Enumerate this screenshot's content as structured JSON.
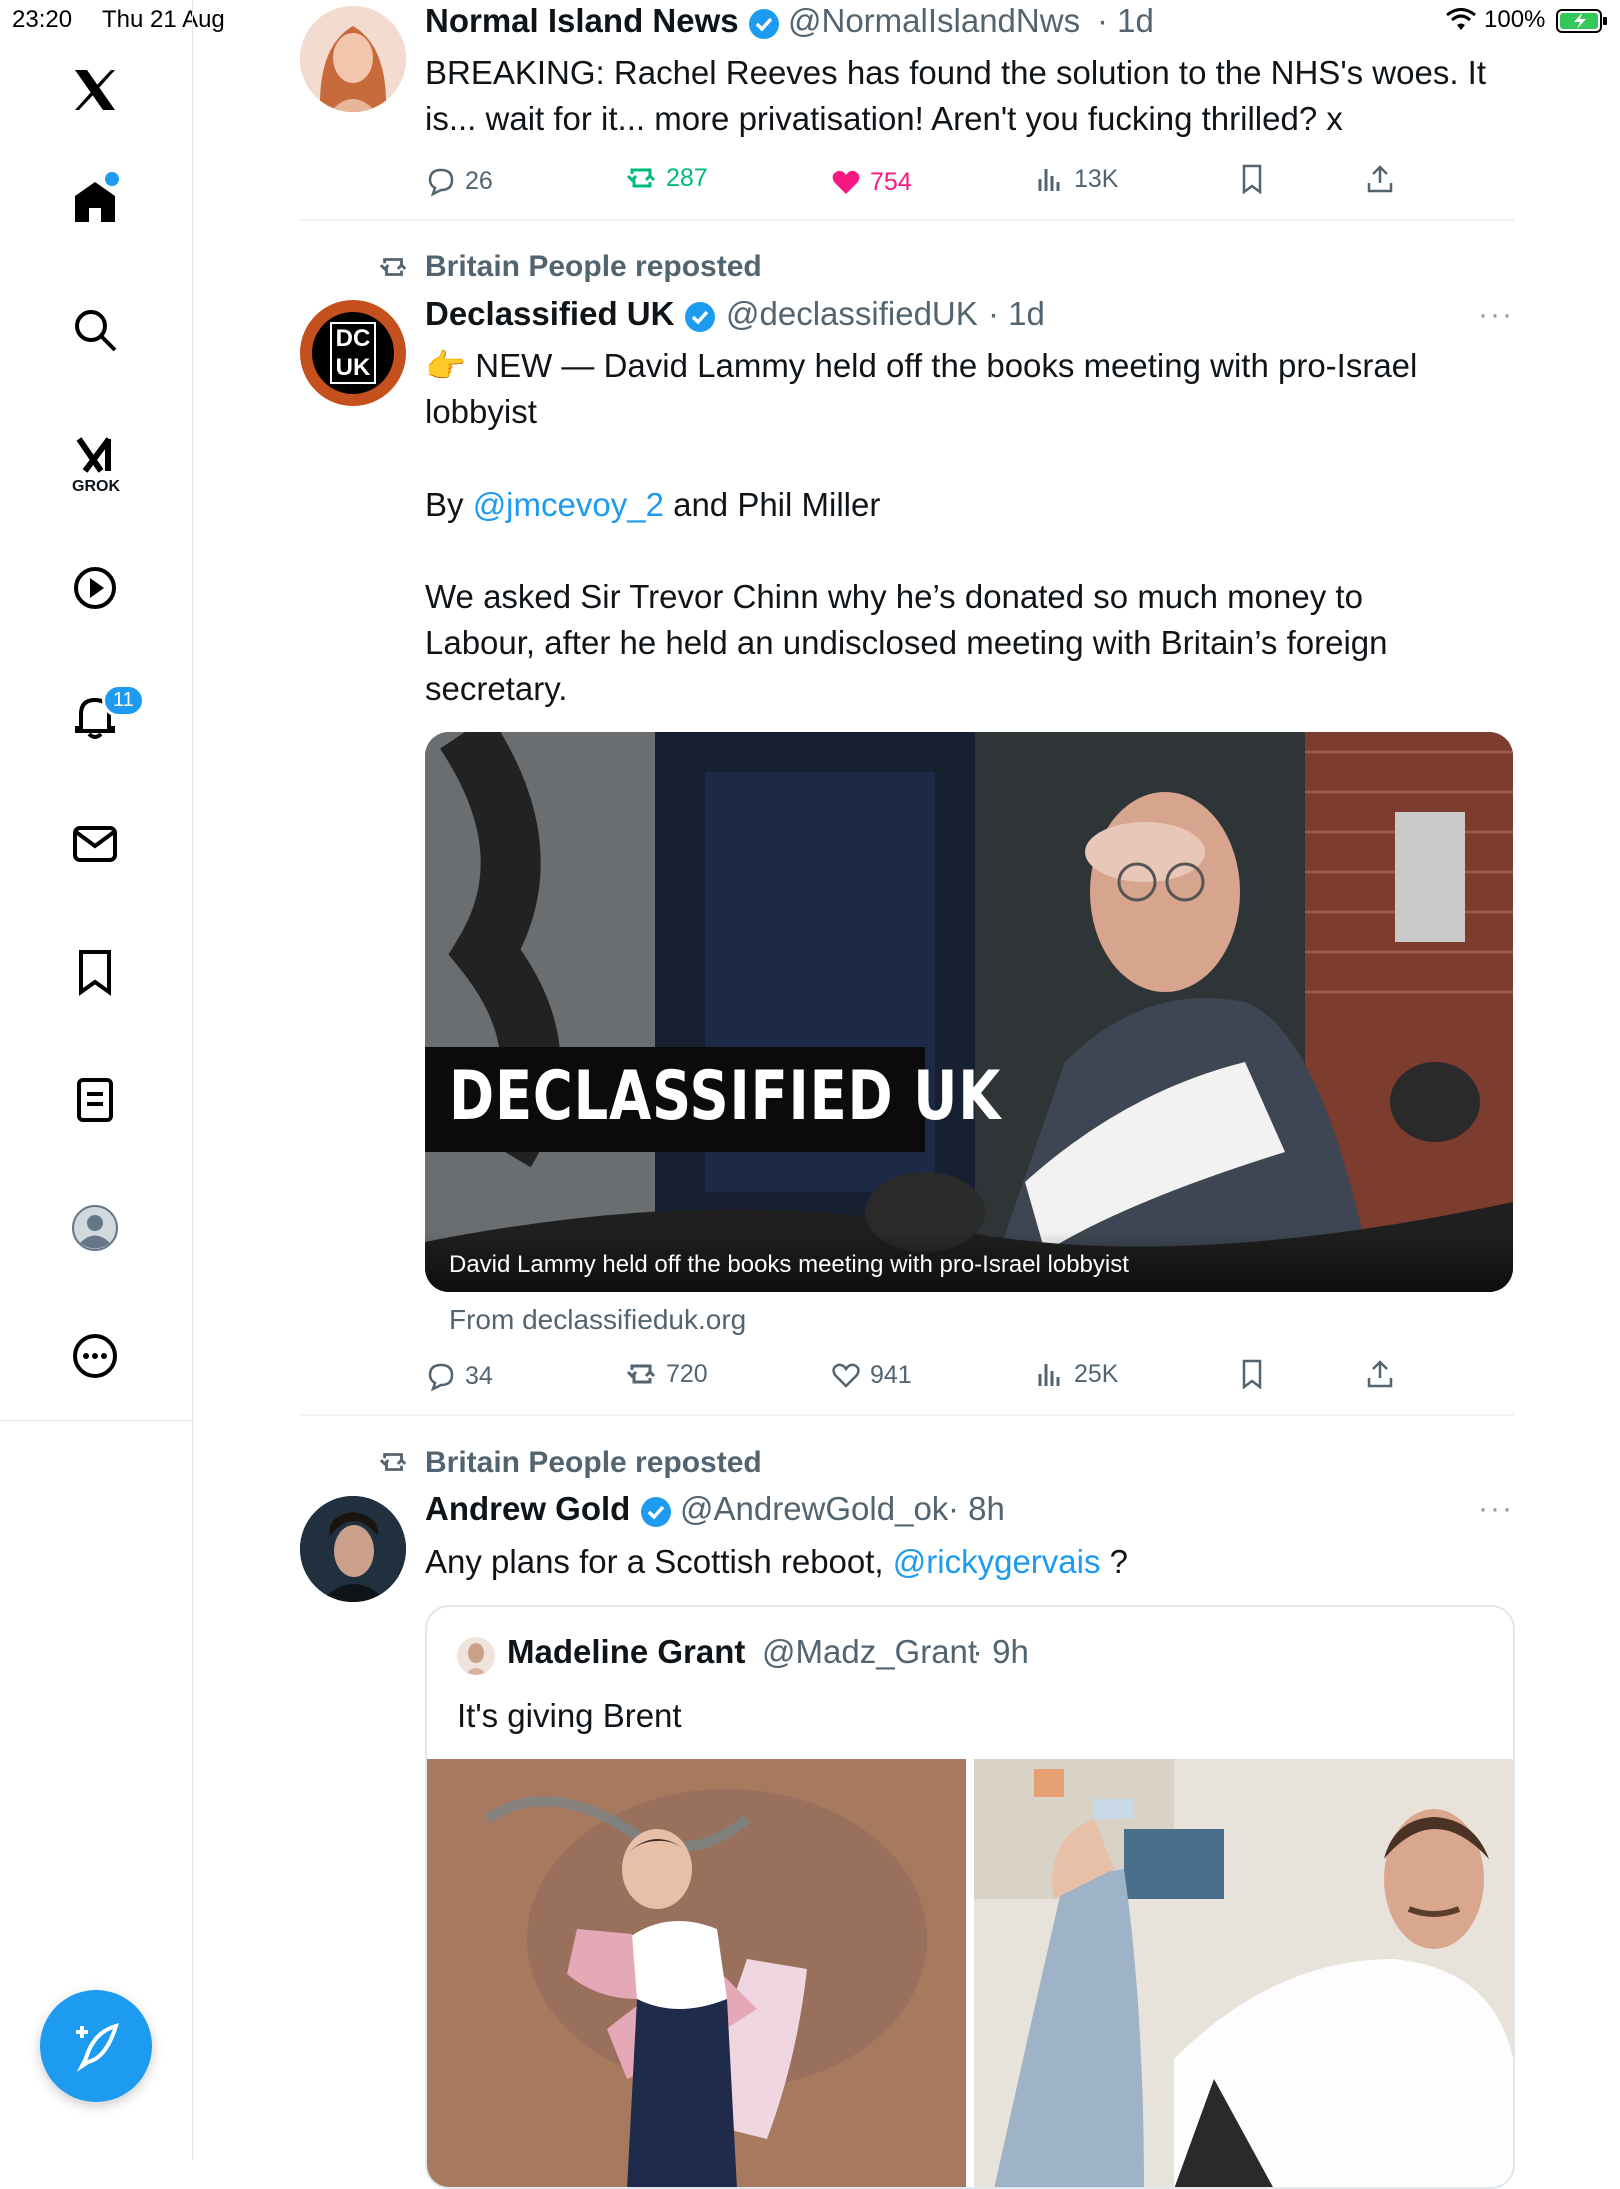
{
  "status_bar": {
    "time": "23:20",
    "date": "Thu 21 Aug",
    "battery": "100%"
  },
  "sidebar": {
    "grok_label": "GROK",
    "notifications_badge": "11",
    "icons": [
      "x-logo-icon",
      "home-icon",
      "search-icon",
      "grok-icon",
      "video-icon",
      "notifications-icon",
      "messages-icon",
      "bookmarks-icon",
      "lists-icon",
      "profile-icon",
      "more-icon"
    ]
  },
  "tweets": [
    {
      "name": "Normal Island News",
      "handle": "@NormalIslandNws",
      "time": "· 1d",
      "text_line1": "BREAKING: Rachel Reeves has found the solution to the NHS's woes. It",
      "text_line2": "is... wait for it... more privatisation! Aren't you fucking thrilled? x",
      "replies": "26",
      "reposts": "287",
      "likes": "754",
      "views": "13K"
    },
    {
      "repost_by": "Britain People reposted",
      "name": "Declassified UK",
      "handle": "@declassifiedUK",
      "time": "· 1d",
      "avatar_text": "DC UK",
      "text_p1_line1": "👉 NEW — David Lammy held off the books meeting with pro-Israel",
      "text_p1_line2": "lobbyist",
      "by_prefix": "By ",
      "by_mention": "@jmcevoy_2",
      "by_suffix": " and Phil Miller",
      "text_p3_line1": "We asked Sir Trevor Chinn why he’s donated so much money to",
      "text_p3_line2": "Labour,  after he held an undisclosed meeting with Britain’s foreign",
      "text_p3_line3": "secretary.",
      "card_overlay": "DECLASSIFIED UK",
      "card_caption": "David Lammy held off the books meeting with pro-Israel lobbyist",
      "card_source": "From declassifieduk.org",
      "replies": "34",
      "reposts": "720",
      "likes": "941",
      "views": "25K"
    },
    {
      "repost_by": "Britain People reposted",
      "name": "Andrew Gold",
      "handle": "@AndrewGold_ok",
      "time": "· 8h",
      "text_prefix": "Any plans for a Scottish reboot, ",
      "text_mention": "@rickygervais",
      "text_suffix": " ?",
      "quote": {
        "name": "Madeline Grant",
        "handle": "@Madz_Grant",
        "time": "· 9h",
        "text": "It's giving Brent"
      }
    }
  ],
  "colors": {
    "accent": "#1d9bf0",
    "like": "#f91880",
    "repost": "#00ba7c",
    "muted": "#536471"
  }
}
